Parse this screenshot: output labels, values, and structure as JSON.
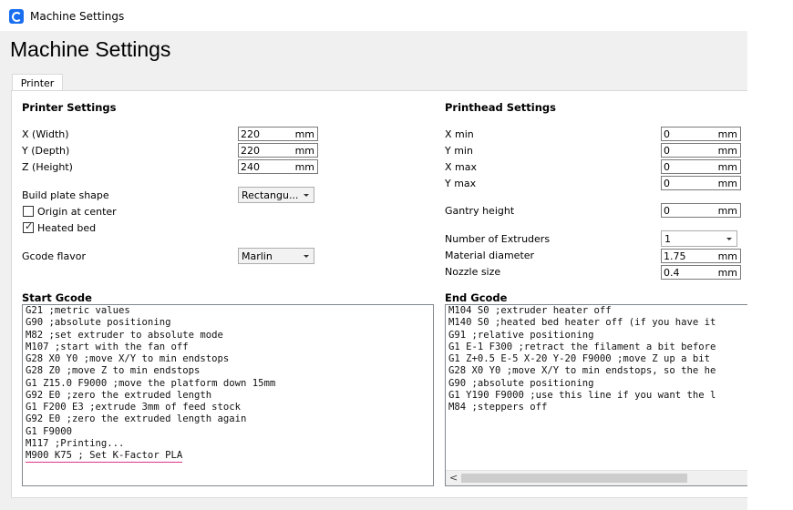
{
  "window": {
    "title": "Machine Settings"
  },
  "page": {
    "title": "Machine Settings"
  },
  "tabs": [
    {
      "label": "Printer"
    }
  ],
  "printer_settings": {
    "title": "Printer Settings",
    "width": {
      "label": "X (Width)",
      "value": "220",
      "unit": "mm"
    },
    "depth": {
      "label": "Y (Depth)",
      "value": "220",
      "unit": "mm"
    },
    "height": {
      "label": "Z (Height)",
      "value": "240",
      "unit": "mm"
    },
    "build_plate_shape": {
      "label": "Build plate shape",
      "value": "Rectangu..."
    },
    "origin_at_center": {
      "label": "Origin at center",
      "checked": false
    },
    "heated_bed": {
      "label": "Heated bed",
      "checked": true,
      "mark": "✓"
    },
    "gcode_flavor": {
      "label": "Gcode flavor",
      "value": "Marlin"
    }
  },
  "printhead_settings": {
    "title": "Printhead Settings",
    "x_min": {
      "label": "X min",
      "value": "0",
      "unit": "mm"
    },
    "y_min": {
      "label": "Y min",
      "value": "0",
      "unit": "mm"
    },
    "x_max": {
      "label": "X max",
      "value": "0",
      "unit": "mm"
    },
    "y_max": {
      "label": "Y max",
      "value": "0",
      "unit": "mm"
    },
    "gantry_height": {
      "label": "Gantry height",
      "value": "0",
      "unit": "mm"
    },
    "number_of_extruders": {
      "label": "Number of Extruders",
      "value": "1"
    },
    "material_diameter": {
      "label": "Material diameter",
      "value": "1.75",
      "unit": "mm"
    },
    "nozzle_size": {
      "label": "Nozzle size",
      "value": "0.4",
      "unit": "mm"
    }
  },
  "start_gcode": {
    "title": "Start Gcode",
    "lines": [
      "G21 ;metric values",
      "G90 ;absolute positioning",
      "M82 ;set extruder to absolute mode",
      "M107 ;start with the fan off",
      "G28 X0 Y0 ;move X/Y to min endstops",
      "G28 Z0 ;move Z to min endstops",
      "G1 Z15.0 F9000 ;move the platform down 15mm",
      "G92 E0 ;zero the extruded length",
      "G1 F200 E3 ;extrude 3mm of feed stock",
      "G92 E0 ;zero the extruded length again",
      "G1 F9000",
      "M117 ;Printing...",
      "M900 K75 ; Set K-Factor PLA"
    ]
  },
  "end_gcode": {
    "title": "End Gcode",
    "lines": [
      "M104 S0 ;extruder heater off",
      "M140 S0 ;heated bed heater off (if you have it",
      "G91 ;relative positioning",
      "G1 E-1 F300 ;retract the filament a bit before",
      "G1 Z+0.5 E-5 X-20 Y-20 F9000 ;move Z up a bit",
      "G28 X0 Y0 ;move X/Y to min endstops, so the he",
      "G90 ;absolute positioning",
      "G1 Y190 F9000 ;use this line if you want the l",
      "M84 ;steppers off"
    ],
    "scroll_left_glyph": "<"
  },
  "colors": {
    "highlight_underline": "#e0328c",
    "app_icon": "#196ef0"
  }
}
